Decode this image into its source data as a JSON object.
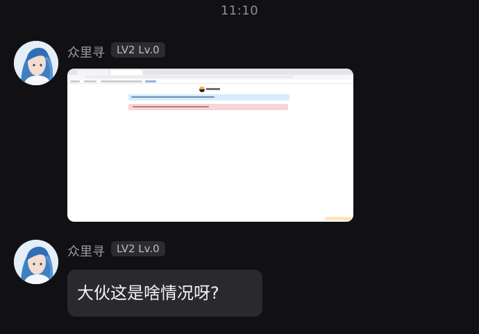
{
  "status": {
    "time": "11:10"
  },
  "messages": [
    {
      "sender": {
        "name": "众里寻",
        "badge": "LV2 Lv.0"
      },
      "type": "image"
    },
    {
      "sender": {
        "name": "众里寻",
        "badge": "LV2 Lv.0"
      },
      "type": "text",
      "text": "大伙这是啥情况呀?"
    }
  ],
  "colors": {
    "background": "#111114",
    "bubble": "#2a2a2d",
    "badge_bg": "#2c2c30",
    "name_text": "#9a9aa0"
  }
}
